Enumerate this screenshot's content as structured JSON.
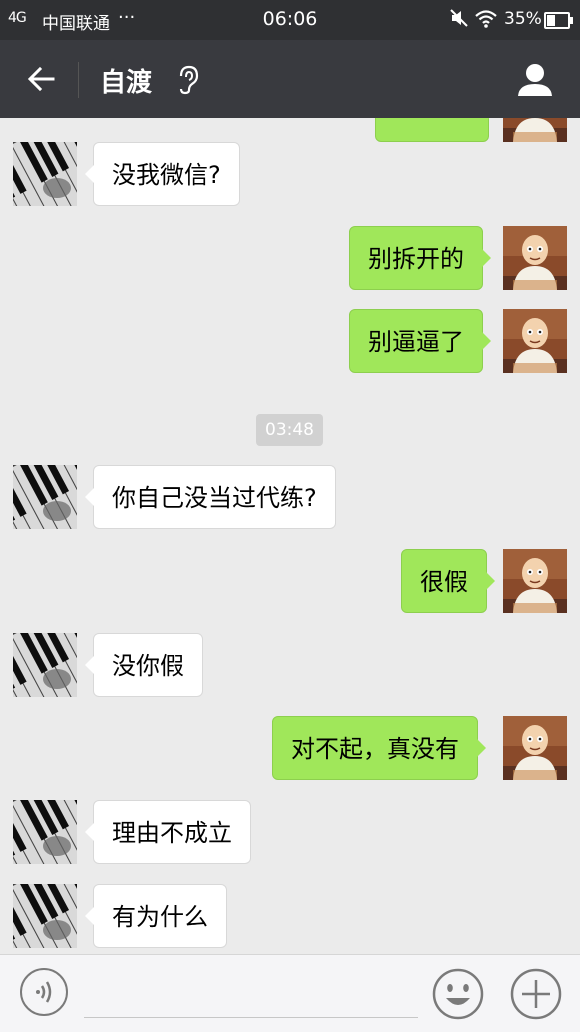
{
  "status_bar": {
    "signal": "4G",
    "carrier": "中国联通",
    "more": "···",
    "time": "06:06",
    "battery": "35%",
    "battery_level": 0.35
  },
  "header": {
    "title": "自渡",
    "back_icon": "arrow-left-icon",
    "mode_icon": "ear-icon",
    "profile_icon": "person-icon"
  },
  "chat": {
    "timestamp": "03:48",
    "messages": [
      {
        "side": "left",
        "text": "没我微信?"
      },
      {
        "side": "right",
        "text": "别拆开的"
      },
      {
        "side": "right",
        "text": "别逼逼了"
      },
      {
        "side": "left",
        "text": "你自己没当过代练?"
      },
      {
        "side": "right",
        "text": "很假"
      },
      {
        "side": "left",
        "text": "没你假"
      },
      {
        "side": "right",
        "text": "对不起，真没有"
      },
      {
        "side": "left",
        "text": "理由不成立"
      },
      {
        "side": "left",
        "text": "有为什么"
      }
    ]
  },
  "input_bar": {
    "voice_icon": "voice-icon",
    "emoji_icon": "emoji-icon",
    "more_icon": "plus-icon"
  },
  "colors": {
    "sent_bubble": "#a0e75a",
    "received_bubble": "#ffffff",
    "nav_background": "#393a3f",
    "chat_background": "#ebebeb"
  }
}
